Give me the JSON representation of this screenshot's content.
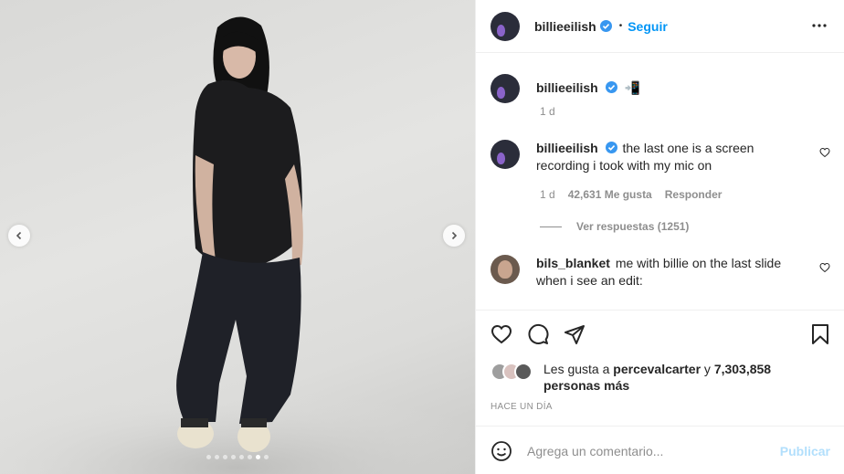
{
  "post": {
    "username": "billieeilish",
    "follow_label": "Seguir",
    "separator": "•",
    "more_icon": "more-horizontal-icon",
    "carousel": {
      "slide_count": 8,
      "active_index": 6
    }
  },
  "caption": {
    "username": "billieeilish",
    "emoji": "📲",
    "time": "1 d"
  },
  "comments": [
    {
      "username": "billieeilish",
      "text": "the last one is a screen recording i took with my mic on",
      "time": "1 d",
      "likes": "42,631 Me gusta",
      "reply_label": "Responder",
      "view_replies": "Ver respuestas (1251)"
    },
    {
      "username": "bils_blanket",
      "text": "me with billie on the last slide when i see an edit:"
    }
  ],
  "likes": {
    "prefix": "Les gusta a",
    "user": "percevalcarter",
    "conj": "y",
    "count": "7,303,858 personas más"
  },
  "time_ago": "HACE UN DÍA",
  "composer": {
    "placeholder": "Agrega un comentario...",
    "publish_label": "Publicar"
  },
  "colors": {
    "accent": "#0095f6",
    "verified": "#3897f0",
    "publish_disabled": "#b2dffc"
  }
}
